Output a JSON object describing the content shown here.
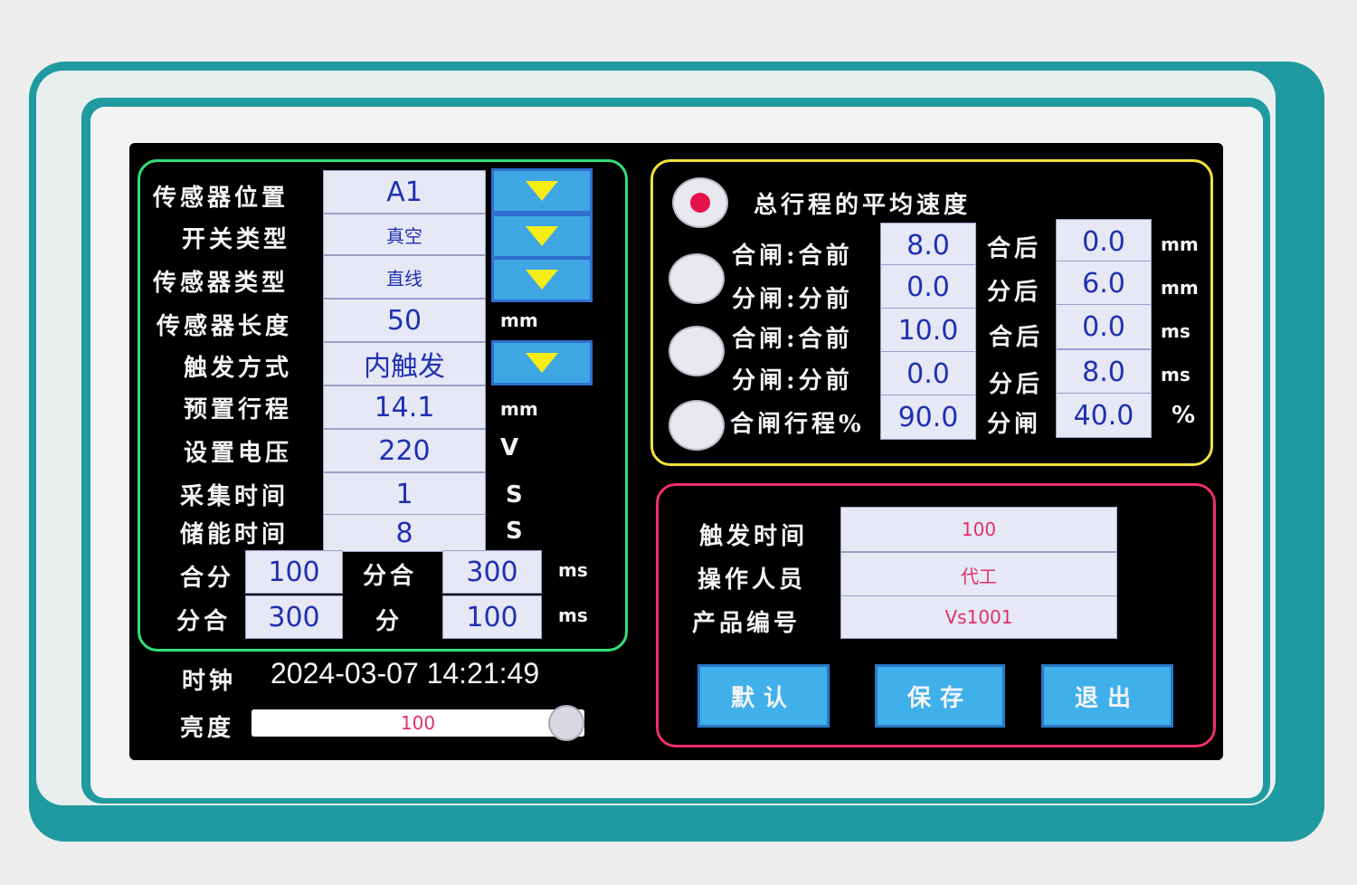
{
  "sensor": {
    "rows": [
      {
        "label": "传感器位置",
        "value": "A1",
        "unit": "",
        "dropdown": true
      },
      {
        "label": "开关类型",
        "value": "真空",
        "unit": "",
        "dropdown": true
      },
      {
        "label": "传感器类型",
        "value": "直线",
        "unit": "",
        "dropdown": true
      },
      {
        "label": "传感器长度",
        "value": "50",
        "unit": "mm",
        "dropdown": false
      },
      {
        "label": "触发方式",
        "value": "内触发",
        "unit": "",
        "dropdown": true
      },
      {
        "label": "预置行程",
        "value": "14.1",
        "unit": "mm",
        "dropdown": false
      },
      {
        "label": "设置电压",
        "value": "220",
        "unit": "V",
        "dropdown": false
      },
      {
        "label": "采集时间",
        "value": "1",
        "unit": "S",
        "dropdown": false
      },
      {
        "label": "储能时间",
        "value": "8",
        "unit": "S",
        "dropdown": false
      }
    ],
    "pairs": [
      {
        "label1": "合分",
        "value1": "100",
        "label2": "分合",
        "value2": "300",
        "unit": "ms"
      },
      {
        "label1": "分合",
        "value1": "300",
        "label2": "分",
        "value2": "100",
        "unit": "ms"
      }
    ]
  },
  "clock": {
    "label": "时钟",
    "value": "2024-03-07 14:21:49"
  },
  "brightness": {
    "label": "亮度",
    "value": "100",
    "level_percent": 100
  },
  "speed": {
    "title": "总行程的平均速度",
    "selected_index": 0,
    "rows": [
      {
        "label": "合闸:合前",
        "value1": "8.0",
        "label2": "合后",
        "value2": "0.0",
        "unit": "mm"
      },
      {
        "label": "分闸:分前",
        "value1": "0.0",
        "label2": "分后",
        "value2": "6.0",
        "unit": "mm"
      },
      {
        "label": "合闸:合前",
        "value1": "10.0",
        "label2": "合后",
        "value2": "0.0",
        "unit": "ms"
      },
      {
        "label": "分闸:分前",
        "value1": "0.0",
        "label2": "分后",
        "value2": "8.0",
        "unit": "ms"
      },
      {
        "label": "合闸行程%",
        "value1": "90.0",
        "label2": "分闸",
        "value2": "40.0",
        "unit": "%"
      }
    ]
  },
  "info": {
    "rows": [
      {
        "label": "触发时间",
        "value": "100"
      },
      {
        "label": "操作人员",
        "value": "代工"
      },
      {
        "label": "产品编号",
        "value": "Vs1001"
      }
    ]
  },
  "buttons": {
    "default": "默认",
    "save": "保存",
    "exit": "退出"
  },
  "colors": {
    "panel_green": "#2fe07a",
    "panel_yellow": "#f2e23a",
    "panel_pink": "#f02d6d",
    "button_blue": "#3fb0ea",
    "device_teal": "#1f9aa0"
  }
}
